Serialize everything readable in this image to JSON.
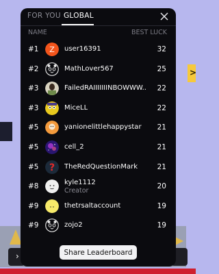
{
  "tabs": [
    {
      "label": "FOR YOU",
      "active": false
    },
    {
      "label": "GLOBAL",
      "active": true
    }
  ],
  "close_icon": "close-icon",
  "columns": {
    "name": "NAME",
    "score": "BEST LUCK"
  },
  "rows": [
    {
      "rank": "#1",
      "username": "user16391",
      "sub": "",
      "score": "32",
      "avatar": "letter-z",
      "avatar_color": "#f2541b",
      "avatar_letter": "Z"
    },
    {
      "rank": "#2",
      "username": "MathLover567",
      "sub": "",
      "score": "25",
      "avatar": "panda-outline"
    },
    {
      "rank": "#3",
      "username": "FailedRAIIIIIIINBOWWW...",
      "sub": "",
      "score": "22",
      "avatar": "photo-portrait"
    },
    {
      "rank": "#3",
      "username": "MiceLL",
      "sub": "",
      "score": "22",
      "avatar": "yellow-cartoon"
    },
    {
      "rank": "#5",
      "username": "yanionelittlehappystar",
      "sub": "",
      "score": "21",
      "avatar": "orange-face"
    },
    {
      "rank": "#5",
      "username": "cell_2",
      "sub": "",
      "score": "21",
      "avatar": "galaxy"
    },
    {
      "rank": "#5",
      "username": "TheRedQuestionMark",
      "sub": "",
      "score": "21",
      "avatar": "red-question-mark"
    },
    {
      "rank": "#8",
      "username": "kyle1112",
      "sub": "Creator",
      "score": "20",
      "avatar": "white-face"
    },
    {
      "rank": "#9",
      "username": "thetrsaltaccount",
      "sub": "",
      "score": "19",
      "avatar": "yellow-dots"
    },
    {
      "rank": "#9",
      "username": "zojo2",
      "sub": "",
      "score": "19",
      "avatar": "panda-outline"
    }
  ],
  "share_button": "Share Leaderboard",
  "background": {
    "left_tab_glyph": "›",
    "right_tab_glyph": ">"
  },
  "colors": {
    "modal_bg": "#0b0b0f",
    "page_bg": "#b7b7ee",
    "accent_red": "#cf1f2e"
  }
}
